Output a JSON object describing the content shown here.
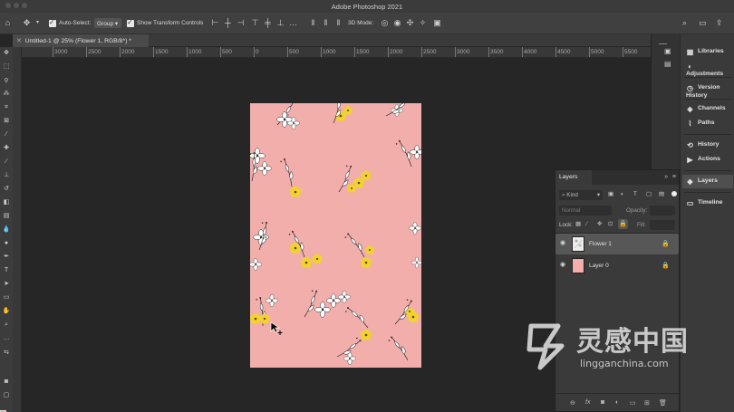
{
  "window": {
    "title": "Adobe Photoshop 2021"
  },
  "options_bar": {
    "auto_select_label": "Auto-Select:",
    "auto_select_target": "Group",
    "show_transform_label": "Show Transform Controls",
    "mode_3d_label": "3D Mode:"
  },
  "document": {
    "tab_title": "Untitled-1 @ 25% (Flower 1, RGB/8*) *"
  },
  "ruler": {
    "ticks": [
      "3000",
      "2500",
      "2000",
      "1500",
      "1000",
      "500",
      "0",
      "500",
      "1000",
      "1500",
      "2000",
      "2500",
      "3000",
      "3500",
      "4000",
      "4500",
      "5000",
      "5500"
    ]
  },
  "dock": {
    "items": [
      {
        "label": "Libraries",
        "icon": "libraries-icon"
      },
      {
        "label": "Adjustments",
        "icon": "adjustments-icon"
      },
      {
        "label": "Version History",
        "icon": "version-history-icon"
      },
      {
        "label": "Channels",
        "icon": "channels-icon"
      },
      {
        "label": "Paths",
        "icon": "paths-icon"
      },
      {
        "label": "History",
        "icon": "history-icon"
      },
      {
        "label": "Actions",
        "icon": "actions-icon"
      },
      {
        "label": "Layers",
        "icon": "layers-icon"
      },
      {
        "label": "Timeline",
        "icon": "timeline-icon"
      }
    ]
  },
  "layers_panel": {
    "title": "Layers",
    "filter_kind": "Kind",
    "blend_mode": "Normal",
    "opacity_label": "Opacity:",
    "lock_label": "Lock:",
    "fill_label": "Fill:",
    "layers": [
      {
        "name": "Flower 1",
        "selected": true,
        "thumb_color": "#f0ece8",
        "locked": true
      },
      {
        "name": "Layer 0",
        "selected": false,
        "thumb_color": "#f2aeab",
        "locked": true
      }
    ]
  },
  "colors": {
    "canvas_bg": "#f2aeab",
    "foreground": "#e7a8a3",
    "background": "#5aa86b",
    "flower_yellow": "#f1d22f"
  },
  "watermark": {
    "text": "灵感中国",
    "url": "lingganchina.com"
  }
}
